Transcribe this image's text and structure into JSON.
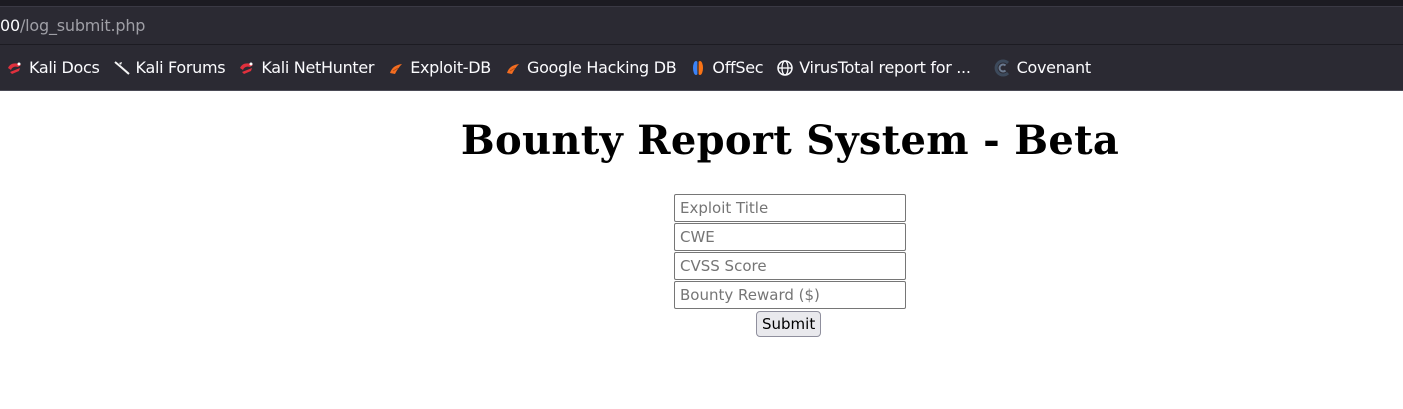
{
  "browser": {
    "url_host": "00",
    "url_path": "/log_submit.php",
    "bookmarks": [
      {
        "label": "Kali Docs",
        "icon": "kali-dragon-icon"
      },
      {
        "label": "Kali Forums",
        "icon": "kali-dragon-icon"
      },
      {
        "label": "Kali NetHunter",
        "icon": "kali-dragon-icon"
      },
      {
        "label": "Exploit-DB",
        "icon": "exploit-db-icon"
      },
      {
        "label": "Google Hacking DB",
        "icon": "exploit-db-icon"
      },
      {
        "label": "OffSec",
        "icon": "offsec-icon"
      },
      {
        "label": "VirusTotal report for ...",
        "icon": "globe-icon"
      },
      {
        "label": "Covenant",
        "icon": "covenant-icon"
      }
    ]
  },
  "page": {
    "title": "Bounty Report System - Beta",
    "form": {
      "exploit_title_placeholder": "Exploit Title",
      "cwe_placeholder": "CWE",
      "cvss_placeholder": "CVSS Score",
      "reward_placeholder": "Bounty Reward ($)",
      "submit_label": "Submit"
    }
  },
  "colors": {
    "toolbar_bg": "#2b2a33",
    "toolbar_text": "#fbfbfe",
    "url_path_text": "#9f9fa6",
    "kali_red": "#e0303d",
    "exploit_orange": "#f36d21",
    "page_bg": "#ffffff"
  }
}
